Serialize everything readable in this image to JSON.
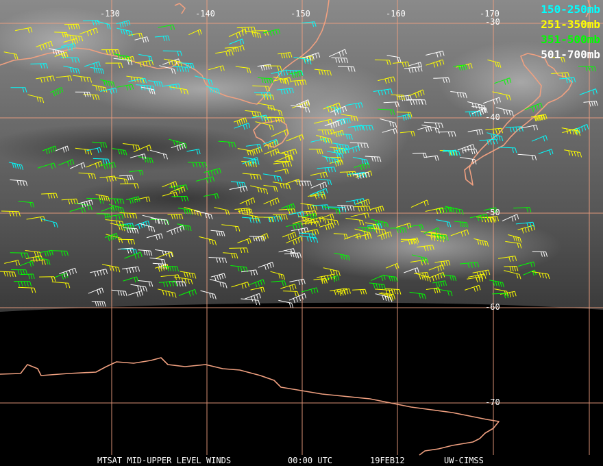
{
  "map": {
    "longitude_labels": [
      "-130",
      "-140",
      "-150",
      "-160",
      "-170"
    ],
    "latitude_labels": [
      "-30",
      "-40",
      "-50",
      "-60",
      "-70"
    ],
    "legend": [
      {
        "label": "150-250mb",
        "color": "#00ffff"
      },
      {
        "label": "251-350mb",
        "color": "#ffff00"
      },
      {
        "label": "351-500mb",
        "color": "#00ff00"
      },
      {
        "label": "501-700mb",
        "color": "#ffffff"
      }
    ],
    "colors": {
      "coastline": "#f0a080",
      "gridline": "#f0a080",
      "space": "#000000"
    }
  },
  "footer": {
    "product": "MTSAT MID-UPPER LEVEL WINDS",
    "time": "00:00 UTC",
    "date": "19FEB12",
    "source": "UW-CIMSS"
  }
}
